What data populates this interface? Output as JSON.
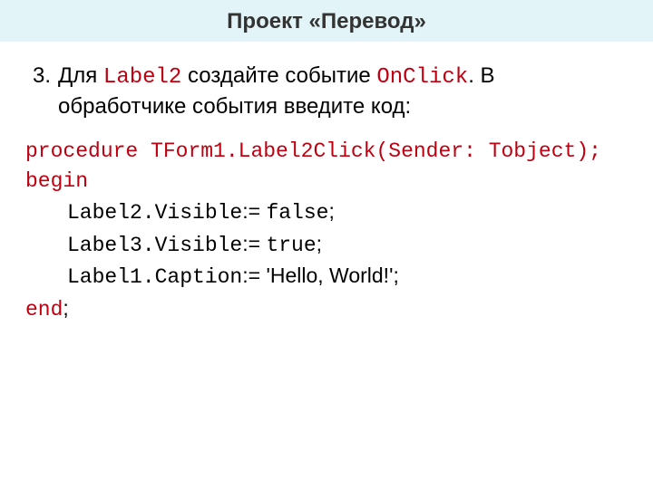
{
  "title": "Проект «Перевод»",
  "instruction": {
    "num": "3.",
    "p1a": "Для ",
    "p1_code1": "Label2",
    "p1b": " создайте событие ",
    "p1_code2": "OnClick",
    "p1c": ". В",
    "p2": "обработчике события введите код:"
  },
  "code": {
    "l1_kw": "procedure",
    "l1_rest": " TForm1.Label2Click(Sender: Tobject);",
    "l2": "begin",
    "l3_a": "Label2.Visible",
    "l3_b": ":= ",
    "l3_c": "false",
    "l3_d": ";",
    "l4_a": "Label3.Visible",
    "l4_b": ":= ",
    "l4_c": "true",
    "l4_d": ";",
    "l5_a": "Label1.Caption",
    "l5_b": ":= 'Hello, World!';",
    "l6_a": "end",
    "l6_b": ";"
  }
}
